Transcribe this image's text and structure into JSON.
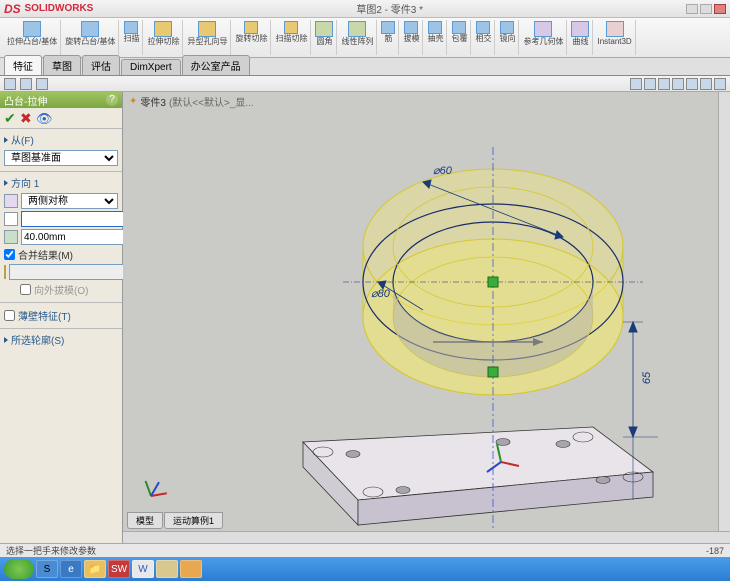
{
  "app": {
    "name": "SOLIDWORKS",
    "title": "草图2 - 零件3 *"
  },
  "ribbon": [
    {
      "label": "拉伸凸台/基体"
    },
    {
      "label": "旋转凸台/基体"
    },
    {
      "label": "扫描"
    },
    {
      "label": "拉伸切除"
    },
    {
      "label": "异型孔向导"
    },
    {
      "label": "旋转切除"
    },
    {
      "label": "扫描切除"
    },
    {
      "label": "圆角"
    },
    {
      "label": "线性阵列"
    },
    {
      "label": "筋"
    },
    {
      "label": "拔模"
    },
    {
      "label": "抽壳"
    },
    {
      "label": "包覆"
    },
    {
      "label": "相交"
    },
    {
      "label": "镜向"
    },
    {
      "label": "参考几何体"
    },
    {
      "label": "曲线"
    },
    {
      "label": "Instant3D"
    }
  ],
  "tabs": [
    "特征",
    "草图",
    "评估",
    "DimXpert",
    "办公室产品"
  ],
  "active_tab": 0,
  "feature": {
    "title": "凸台-拉伸",
    "section_from": "从(F)",
    "from_plane": "草图基准面",
    "section_dir": "方向 1",
    "end_cond": "两侧对称",
    "depth": "",
    "depth2": "40.00mm",
    "merge": "合并结果(M)",
    "outward": "向外拔模(O)",
    "thin": "薄壁特征(T)",
    "contour": "所选轮廓(S)"
  },
  "breadcrumb": {
    "part": "零件3",
    "state": "(默认<<默认>_显..."
  },
  "dims": {
    "d60": "⌀60",
    "d80": "⌀80",
    "h65": "65"
  },
  "bottom_tabs": [
    "模型",
    "运动算例1"
  ],
  "status": {
    "msg": "选择一把手来修改参数",
    "coord": "-187"
  },
  "chart_data": {
    "type": "cad_preview",
    "feature": "Boss-Extrude",
    "sketch_diameters_mm": [
      60,
      80
    ],
    "extrude_depth_mm": 40,
    "reference_height_mm": 65,
    "end_condition": "MidPlane"
  }
}
